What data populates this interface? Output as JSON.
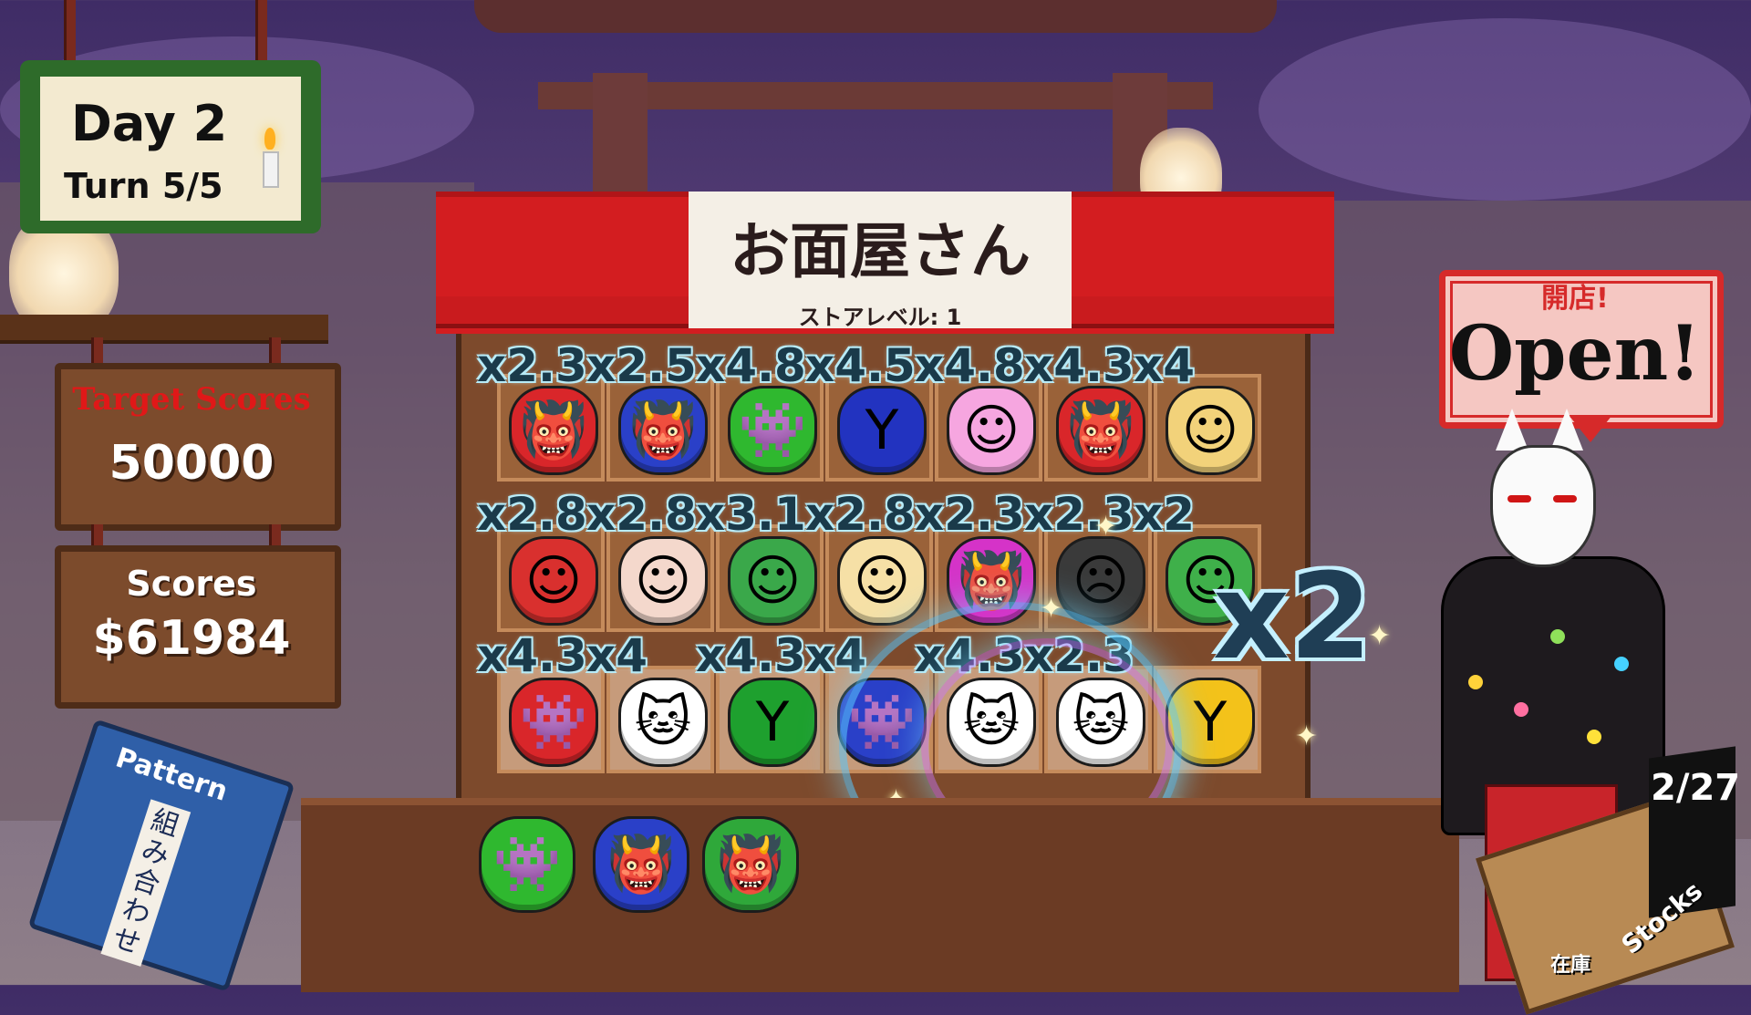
{
  "hud": {
    "day_label": "Day 2",
    "turn_label": "Turn 5/5",
    "target_title": "Target Scores",
    "target_value": "50000",
    "score_title": "Scores",
    "score_value": "$61984",
    "pattern_book_title": "Pattern",
    "pattern_book_subtitle": "組み合わせ"
  },
  "shop": {
    "name": "お面屋さん",
    "store_level": "ストアレベル: 1",
    "open_sign_jp": "開店!",
    "open_sign_en": "Open!"
  },
  "stock": {
    "count": "2/27",
    "label_en": "Stocks",
    "label_jp": "在庫"
  },
  "big_multiplier": "x2",
  "grid": {
    "rows": [
      {
        "multipliers": [
          "x2.3",
          "x2.5",
          "x4.8",
          "x4.5",
          "x4.8",
          "x4.3",
          "x4"
        ],
        "masks": [
          {
            "icon": "red-oni-mask-icon",
            "glyph": "👹",
            "color": "#d9262a"
          },
          {
            "icon": "blue-oni-mask-icon",
            "glyph": "👹",
            "color": "#2a40c8"
          },
          {
            "icon": "green-space-invader-icon",
            "glyph": "👾",
            "color": "#2fb82f"
          },
          {
            "icon": "blue-ranger-mask-icon",
            "glyph": "Y",
            "color": "#2233c0"
          },
          {
            "icon": "pink-anime-girl-mask-icon",
            "glyph": "☺",
            "color": "#f6a6e0"
          },
          {
            "icon": "red-oni-mask-icon",
            "glyph": "👹",
            "color": "#d9262a"
          },
          {
            "icon": "blonde-anime-girl-mask-icon",
            "glyph": "☺",
            "color": "#f2d27a"
          }
        ]
      },
      {
        "multipliers": [
          "x2.8",
          "x2.8",
          "x3.1",
          "x2.8",
          "x2.3",
          "x2.3",
          "x2"
        ],
        "masks": [
          {
            "icon": "red-hair-anime-girl-mask-icon",
            "glyph": "☺",
            "color": "#d9302e"
          },
          {
            "icon": "old-man-mask-icon",
            "glyph": "☺",
            "color": "#f4d8cc"
          },
          {
            "icon": "green-old-man-mask-icon",
            "glyph": "☺",
            "color": "#3aa84a"
          },
          {
            "icon": "okame-smiling-mask-icon",
            "glyph": "☺",
            "color": "#f6e0a6"
          },
          {
            "icon": "magenta-oni-mask-icon",
            "glyph": "👹",
            "color": "#d533c8"
          },
          {
            "icon": "black-tengu-mask-icon",
            "glyph": "☹",
            "color": "#3a3a3a"
          },
          {
            "icon": "green-hair-anime-girl-mask-icon",
            "glyph": "☺",
            "color": "#3fb04a"
          }
        ]
      },
      {
        "multipliers": [
          "x4.3",
          "x4",
          "x4.3",
          "x4",
          "x4.3",
          "x2.3",
          ""
        ],
        "masks": [
          {
            "icon": "red-space-invader-icon",
            "glyph": "👾",
            "color": "#d9262a"
          },
          {
            "icon": "white-cat-mask-icon",
            "glyph": "🐱",
            "color": "#ffffff"
          },
          {
            "icon": "green-ranger-mask-icon",
            "glyph": "Y",
            "color": "#1ea02e"
          },
          {
            "icon": "blue-space-invader-icon",
            "glyph": "👾",
            "color": "#2a40c8"
          },
          {
            "icon": "white-cat-mask-icon",
            "glyph": "🐱",
            "color": "#ffffff"
          },
          {
            "icon": "white-cat-red-bow-mask-icon",
            "glyph": "🐱",
            "color": "#ffffff"
          },
          {
            "icon": "yellow-ranger-mask-icon",
            "glyph": "Y",
            "color": "#f3c21a"
          }
        ]
      }
    ]
  },
  "hand": [
    {
      "icon": "green-space-invader-icon",
      "glyph": "👾",
      "color": "#2fb82f"
    },
    {
      "icon": "blue-oni-mask-icon",
      "glyph": "👹",
      "color": "#2a40c8"
    },
    {
      "icon": "green-oni-mask-icon",
      "glyph": "👹",
      "color": "#2fa83a"
    }
  ]
}
